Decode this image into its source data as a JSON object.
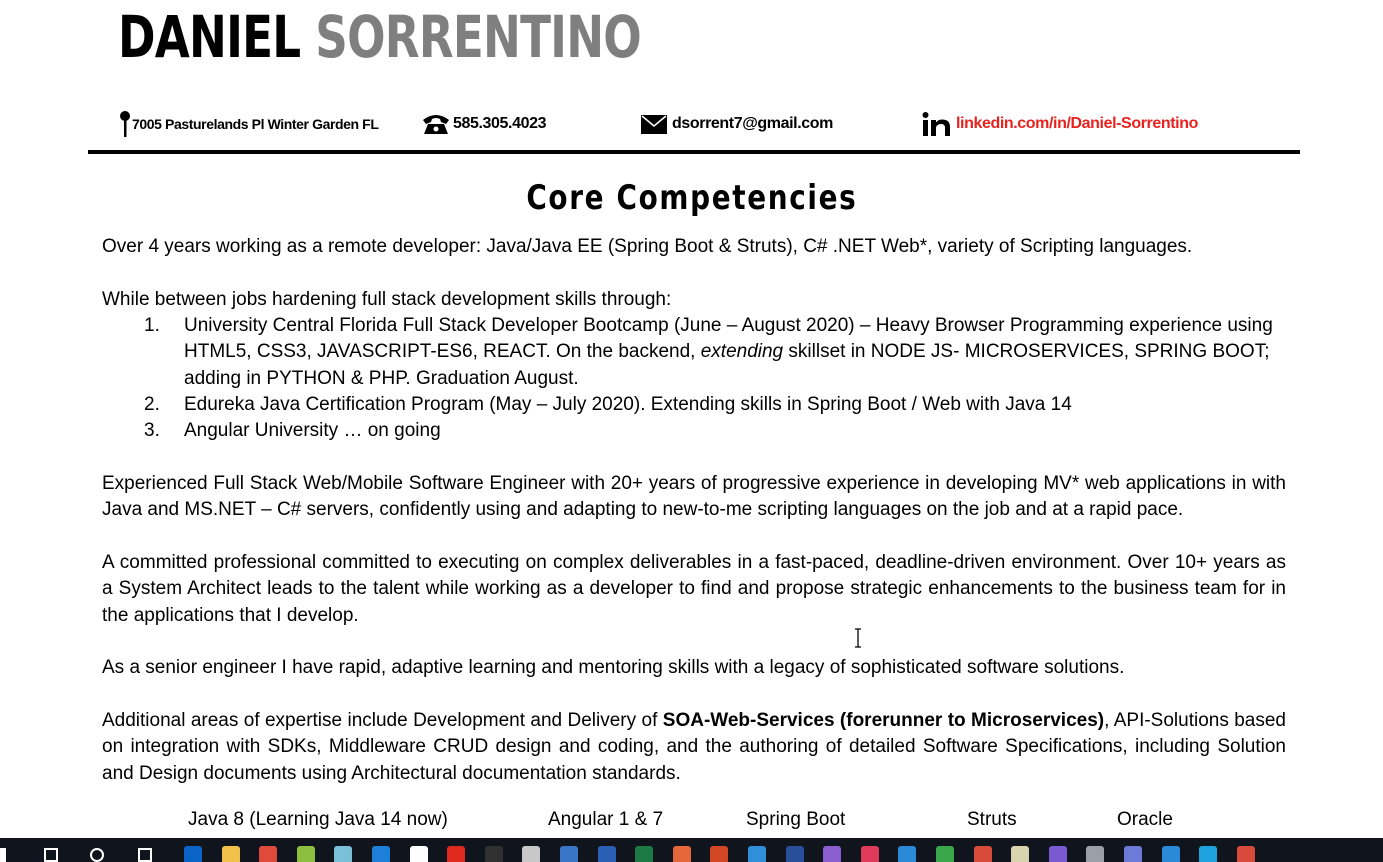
{
  "header": {
    "first_name": "DANIEL",
    "last_name": "SORRENTINO",
    "address": "7005 Pasturelands Pl Winter Garden FL",
    "phone": "585.305.4023",
    "email": "dsorrent7@gmail.com",
    "linkedin": "linkedin.com/in/Daniel-Sorrentino",
    "accent_color": "#e8231f",
    "last_name_color": "#7f7f7f"
  },
  "section_title": "Core Competencies",
  "body": {
    "p1": "Over 4 years working as a remote developer:  Java/Java EE (Spring Boot & Struts), C# .NET Web*, variety of Scripting languages.",
    "p2": "While between jobs hardening full stack development skills through:",
    "list": [
      {
        "num": "1.",
        "part1": "University Central Florida Full Stack Developer Bootcamp (June – August 2020) – Heavy Browser Programming experience using HTML5, CSS3, JAVASCRIPT-ES6, REACT.  On the backend, ",
        "italic": "extending",
        "part2": " skillset in NODE JS- MICROSERVICES, SPRING BOOT; adding in PYTHON & PHP.  Graduation August."
      },
      {
        "num": "2.",
        "text": "Edureka Java Certification Program (May – July 2020).  Extending skills in Spring Boot / Web with Java 14"
      },
      {
        "num": "3.",
        "text": "Angular University … on going"
      }
    ],
    "p3": "Experienced Full Stack Web/Mobile Software Engineer with 20+ years of progressive experience in developing MV* web applications in with Java and MS.NET – C# servers, confidently using  and adapting to new-to-me scripting languages on the job and at a rapid pace.",
    "p4": "A committed professional committed to executing on complex deliverables in a fast-paced, deadline-driven environment.  Over 10+ years as a System Architect leads to the talent while working as a developer to find and propose strategic enhancements to the business team for  in the applications that I develop.",
    "p5": "As a senior engineer I have rapid, adaptive learning and mentoring skills with a legacy of sophisticated software solutions.",
    "p6_start": "Additional areas of expertise include Development and Delivery of ",
    "p6_bold": "SOA-Web-Services (forerunner to Microservices)",
    "p6_end": ", API-Solutions based on integration with SDKs, Middleware CRUD design and coding, and the authoring of detailed Software Specifications, including Solution and Design documents using Architectural documentation standards."
  },
  "skills": [
    "Java 8 (Learning Java 14 now)",
    "Angular 1 & 7",
    "Spring Boot",
    "Struts",
    "Oracle"
  ],
  "taskbar": {
    "icons": [
      {
        "name": "windows-start-icon",
        "color": "#ffffff"
      },
      {
        "name": "search-icon",
        "color": "#ffffff"
      },
      {
        "name": "cortana-icon",
        "color": "#ffffff"
      },
      {
        "name": "task-view-icon",
        "color": "#ffffff"
      },
      {
        "name": "outlook-icon",
        "color": "#0a64c8"
      },
      {
        "name": "file-explorer-icon",
        "color": "#f2c14b"
      },
      {
        "name": "chrome-icon",
        "color": "#e04a3a"
      },
      {
        "name": "app-w-icon",
        "color": "#8cbf3f"
      },
      {
        "name": "app-pen-icon",
        "color": "#7ac0d8"
      },
      {
        "name": "app-blue-icon",
        "color": "#1e7fd8"
      },
      {
        "name": "store-icon",
        "color": "#ffffff"
      },
      {
        "name": "acrobat-icon",
        "color": "#e02a20"
      },
      {
        "name": "terminal-icon",
        "color": "#303030"
      },
      {
        "name": "app-figure-icon",
        "color": "#c8c8c8"
      },
      {
        "name": "app-eclipse-icon",
        "color": "#3a76c8"
      },
      {
        "name": "word-icon",
        "color": "#2b5fb5"
      },
      {
        "name": "excel-icon",
        "color": "#1e7a45"
      },
      {
        "name": "app-pie-icon",
        "color": "#e6673a"
      },
      {
        "name": "powerpoint-icon",
        "color": "#d24625"
      },
      {
        "name": "camera-icon",
        "color": "#2f8fd8"
      },
      {
        "name": "powershell-icon",
        "color": "#2a4f9a"
      },
      {
        "name": "github-icon",
        "color": "#8b5fd0"
      },
      {
        "name": "media-player-icon",
        "color": "#e03a5a"
      },
      {
        "name": "vscode-icon",
        "color": "#2a8ad8"
      },
      {
        "name": "app-tree-icon",
        "color": "#3aa84a"
      },
      {
        "name": "app-tools-icon",
        "color": "#d84a3a"
      },
      {
        "name": "notepad-icon",
        "color": "#d8d4b0"
      },
      {
        "name": "visual-studio-icon",
        "color": "#7a5ad0"
      },
      {
        "name": "app-gray-icon",
        "color": "#9aa0a8"
      },
      {
        "name": "discord-icon",
        "color": "#6e7ad8"
      },
      {
        "name": "edge-icon",
        "color": "#2a8ad8"
      },
      {
        "name": "skype-icon",
        "color": "#1fa3e0"
      },
      {
        "name": "app-check-icon",
        "color": "#d84a3a"
      }
    ]
  }
}
